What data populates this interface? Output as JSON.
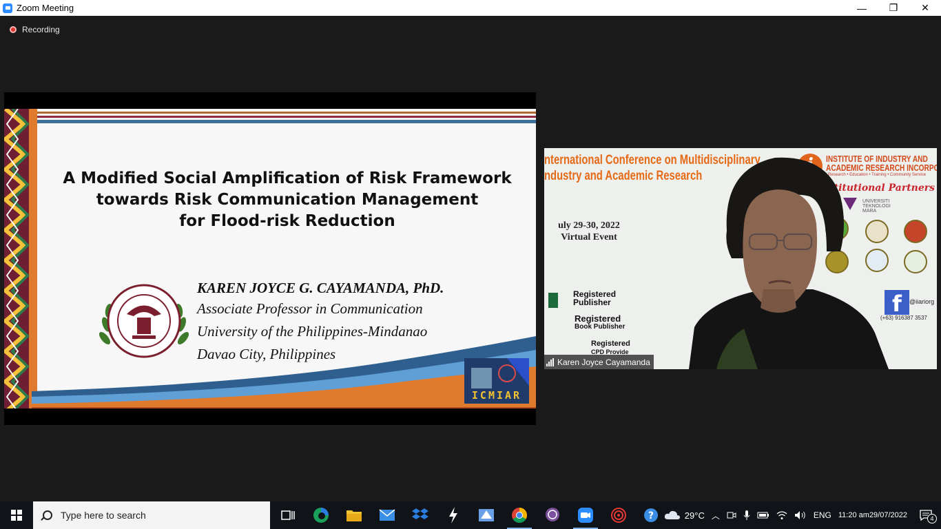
{
  "window": {
    "title": "Zoom Meeting",
    "minimize": "—",
    "maximize": "❐",
    "close": "✕"
  },
  "recording": {
    "label": "Recording"
  },
  "slide": {
    "headline": [
      "A Modified Social Amplification of  Risk Framework",
      "towards Risk Communication Management",
      "for Flood-risk Reduction"
    ],
    "author_name": "KAREN JOYCE G. CAYAMANDA, PhD.",
    "author_lines": [
      "Associate Professor in Communication",
      "University of the Philippines-Mindanao",
      "Davao City, Philippines"
    ],
    "logo_text": "ICMIAR"
  },
  "speaker": {
    "conference_lines": [
      "nternational Conference on Multidisciplinary",
      "ndustry and Academic Research"
    ],
    "dates": "uly 29-30, 2022",
    "event": "Virtual Event",
    "institute_lines": [
      "INSTITUTE OF INDUSTRY AND",
      "ACADEMIC RESEARCH INCORPORATED"
    ],
    "institute_sub": "Research • Education • Training • Community Service",
    "partners": "Institutional Partners",
    "uitm": [
      "UNIVERSITI",
      "TEKNOLOGI",
      "MARA"
    ],
    "reg_publisher": [
      "Registered",
      "Publisher"
    ],
    "reg_book": [
      "Registered",
      "Book Publisher"
    ],
    "reg_cpd": [
      "Registered",
      "CPD Provide"
    ],
    "facebook_handle": "@iiariorg",
    "phone": "(+63) 916387 3537",
    "name": "Karen Joyce Cayamanda"
  },
  "taskbar": {
    "search_placeholder": "Type here to search",
    "weather": "29°C",
    "language": "ENG",
    "time": "11:20 am",
    "date": "29/07/2022",
    "notifications": "4"
  },
  "colors": {
    "zoom_blue": "#2d8cff",
    "record_red": "#e0342f",
    "orange": "#e56a16",
    "maroon": "#8e2b3e"
  }
}
